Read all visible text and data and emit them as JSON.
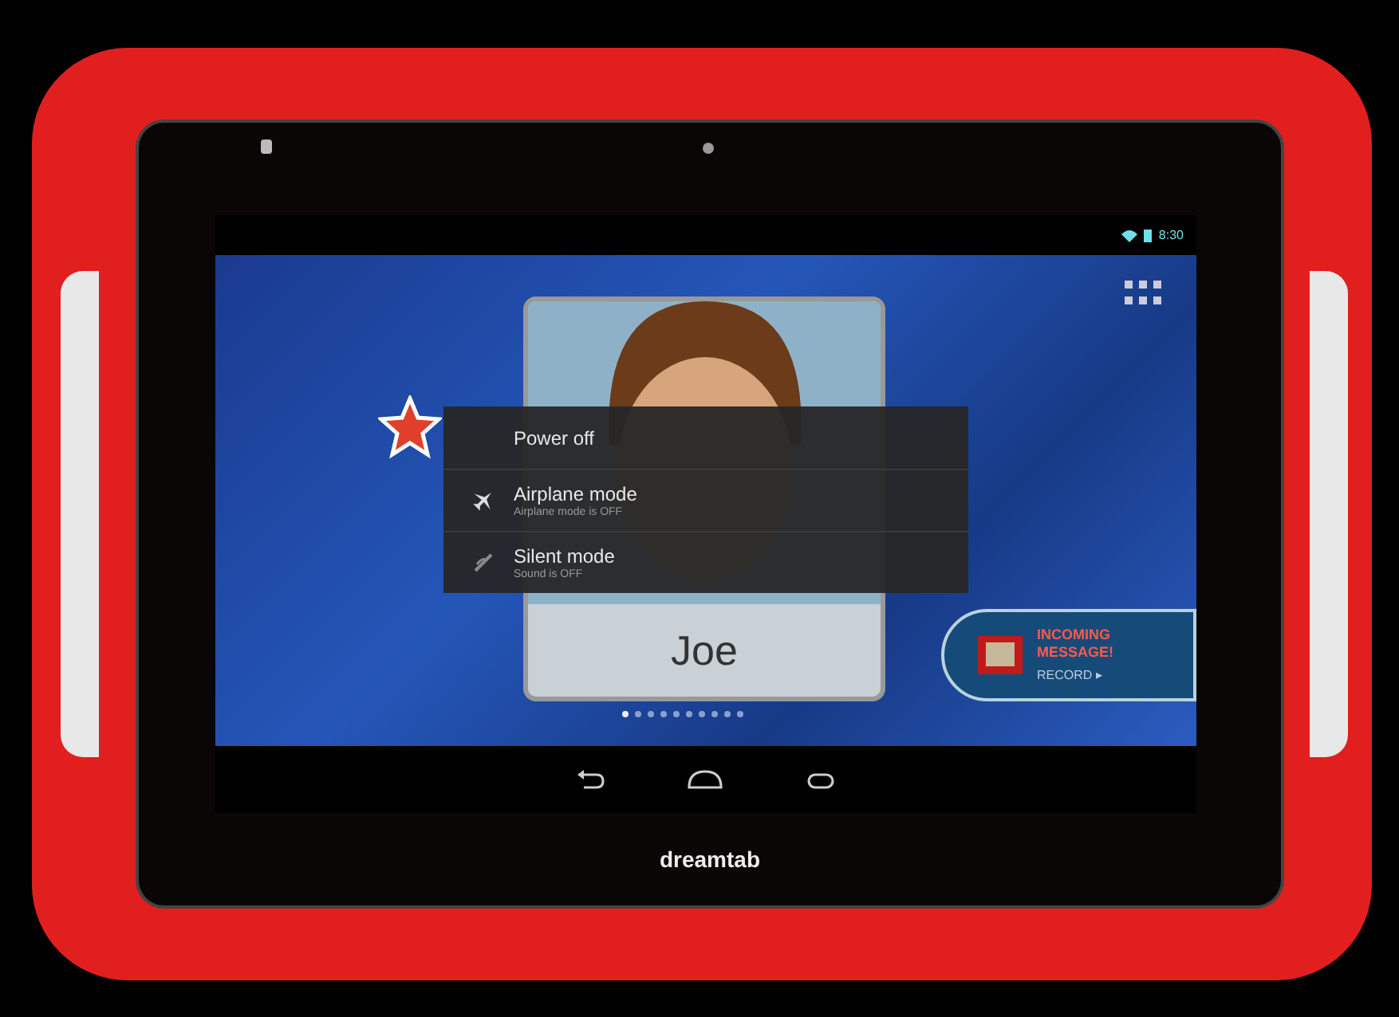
{
  "status_bar": {
    "time": "8:30"
  },
  "profile_card": {
    "name": "Joe"
  },
  "power_menu": {
    "items": [
      {
        "kind": "plain",
        "label": "Power off"
      },
      {
        "kind": "airplane",
        "label": "Airplane mode",
        "status": "Airplane mode is OFF"
      },
      {
        "kind": "silent",
        "label": "Silent mode",
        "status": "Sound is OFF"
      }
    ]
  },
  "page_dots": [
    {
      "selected": true
    },
    {
      "selected": false
    },
    {
      "selected": false
    },
    {
      "selected": false
    },
    {
      "selected": false
    },
    {
      "selected": false
    },
    {
      "selected": false
    },
    {
      "selected": false
    },
    {
      "selected": false
    },
    {
      "selected": false
    }
  ],
  "banner": {
    "title": "INCOMING MESSAGE!",
    "action": "RECORD ▸"
  },
  "device": {
    "brand": "dreamtab"
  }
}
